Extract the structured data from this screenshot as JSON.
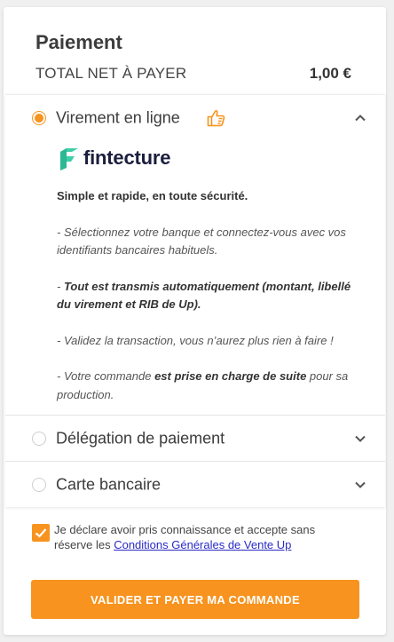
{
  "header": {
    "title": "Paiement",
    "total_label": "TOTAL NET À PAYER",
    "total_amount": "1,00 €"
  },
  "payment_options": [
    {
      "label": "Virement en ligne",
      "selected": true,
      "expanded": true,
      "icon": "thumbs-up-icon",
      "provider_logo_text": "fintecture",
      "description": {
        "headline": "Simple et rapide, en toute sécurité.",
        "step1": "- Sélectionnez votre banque et connectez-vous avec vos identifiants bancaires habituels.",
        "step2_prefix": "- ",
        "step2_bold": "Tout est transmis automatiquement (montant, libellé du virement et RIB de Up).",
        "step3": "- Validez la transaction, vous n’aurez plus rien à faire !",
        "step4_prefix": "- Votre commande ",
        "step4_bold": "est prise en charge de suite",
        "step4_suffix": " pour sa production."
      }
    },
    {
      "label": "Délégation de paiement",
      "selected": false,
      "expanded": false
    },
    {
      "label": "Carte bancaire",
      "selected": false,
      "expanded": false
    }
  ],
  "consent": {
    "checked": true,
    "text_before": "Je déclare avoir pris connaissance et accepte sans réserve les ",
    "link_text": "Conditions Générales de Vente Up"
  },
  "cta": {
    "label": "VALIDER ET PAYER MA COMMANDE"
  },
  "colors": {
    "accent": "#f7931e",
    "link": "#2a2ac6",
    "logo_mark": "#3ccfa8",
    "logo_text": "#1b1e3d"
  }
}
